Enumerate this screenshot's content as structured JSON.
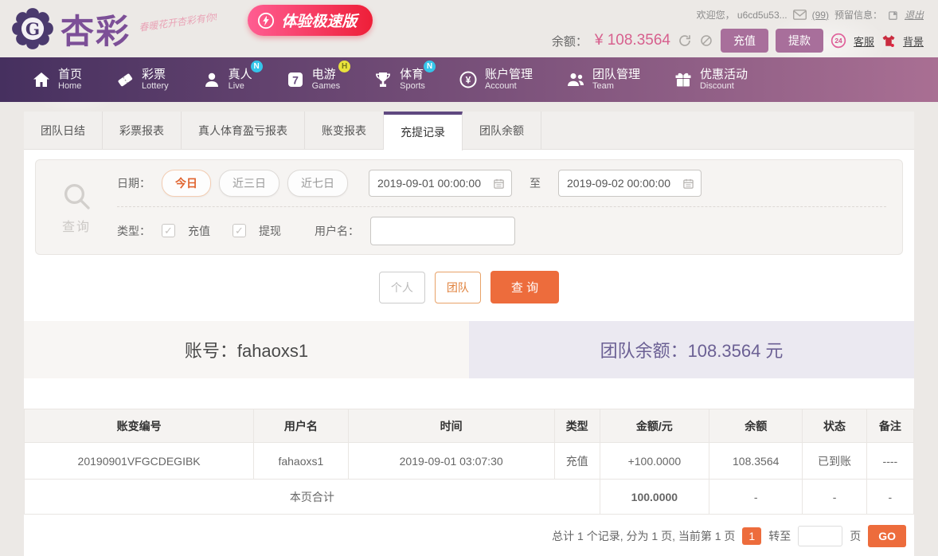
{
  "colors": {
    "accent_orange": "#ED6C3C",
    "nav_gradient_start": "#46305F",
    "nav_gradient_end": "#A96F93",
    "tab_active_bar": "#5F4880",
    "balance_pink": "#D7608E",
    "success_green": "#5CB85C",
    "team_balance_purple": "#6B6094",
    "mauve_button": "#A86F9B",
    "speed_gradient_start": "#FF5D92",
    "speed_gradient_end": "#EE1F38"
  },
  "header": {
    "brand": "杏彩",
    "tagline": "春暖花开杏彩有你!",
    "speed_button_label": "体验极速版",
    "welcome_text": "欢迎您， u6cd5u53...",
    "mail_count": "(99)",
    "reserved_info_label": "预留信息：",
    "logout_label": "退出",
    "balance_label": "余额：",
    "balance_value": "¥ 108.3564",
    "recharge_label": "充值",
    "withdraw_label": "提款",
    "service_badge": "24",
    "service_label": "客服",
    "background_label": "背景"
  },
  "nav": {
    "items": [
      {
        "zh": "首页",
        "en": "Home",
        "badge": ""
      },
      {
        "zh": "彩票",
        "en": "Lottery",
        "badge": ""
      },
      {
        "zh": "真人",
        "en": "Live",
        "badge": "N"
      },
      {
        "zh": "电游",
        "en": "Games",
        "badge": "H"
      },
      {
        "zh": "体育",
        "en": "Sports",
        "badge": "N"
      },
      {
        "zh": "账户管理",
        "en": "Account",
        "badge": ""
      },
      {
        "zh": "团队管理",
        "en": "Team",
        "badge": ""
      },
      {
        "zh": "优惠活动",
        "en": "Discount",
        "badge": ""
      }
    ]
  },
  "tabs": {
    "items": [
      "团队日结",
      "彩票报表",
      "真人体育盈亏报表",
      "账变报表",
      "充提记录",
      "团队余额"
    ],
    "active": "充提记录"
  },
  "filter": {
    "search_label": "查询",
    "date_label": "日期：",
    "quick_ranges": [
      "今日",
      "近三日",
      "近七日"
    ],
    "active_range": "今日",
    "date_from": "2019-09-01 00:00:00",
    "to_label": "至",
    "date_to": "2019-09-02 00:00:00",
    "type_label": "类型：",
    "type_recharge": "充值",
    "type_withdraw": "提现",
    "check_glyph": "✓",
    "username_label": "用户名："
  },
  "actions": {
    "personal_label": "个人",
    "team_label": "团队",
    "query_label": "查 询"
  },
  "account": {
    "account_text": "账号：fahaoxs1",
    "team_balance_text": "团队余额：108.3564 元"
  },
  "table": {
    "columns": [
      "账变编号",
      "用户名",
      "时间",
      "类型",
      "金额/元",
      "余额",
      "状态",
      "备注"
    ],
    "rows": [
      {
        "id": "20190901VFGCDEGIBK",
        "username": "fahaoxs1",
        "time": "2019-09-01 03:07:30",
        "type": "充值",
        "amount": "+100.0000",
        "balance": "108.3564",
        "status": "已到账",
        "remark": "----"
      }
    ],
    "summary": {
      "label": "本页合计",
      "amount": "100.0000",
      "balance": "-",
      "status": "-",
      "remark": "-"
    }
  },
  "pagination": {
    "summary_text": "总计 1 个记录, 分为 1 页, 当前第 1 页",
    "current_page": "1",
    "goto_label": "转至",
    "page_unit_label": "页",
    "go_label": "GO"
  }
}
